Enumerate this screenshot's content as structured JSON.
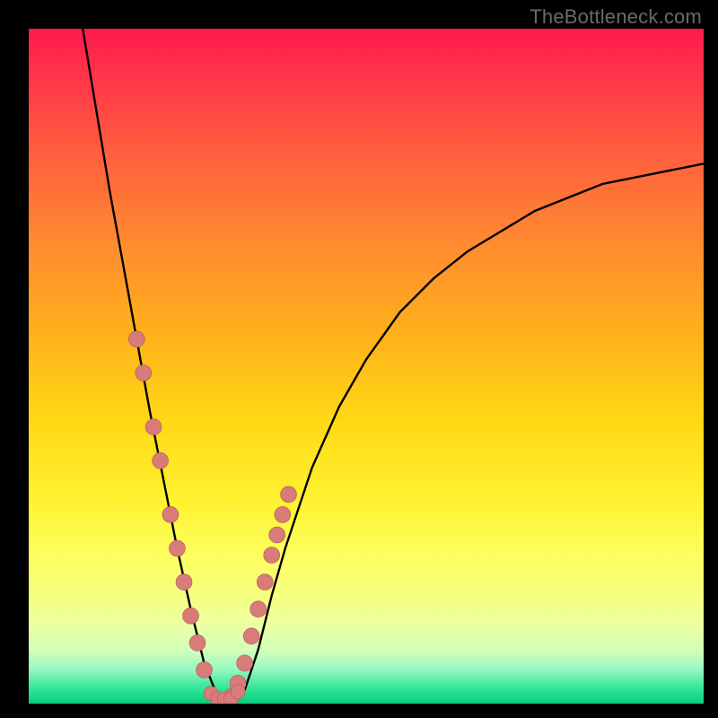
{
  "watermark": {
    "text": "TheBottleneck.com"
  },
  "colors": {
    "frame": "#000000",
    "curve": "#000000",
    "dot_fill": "#d87b79",
    "dot_stroke": "#b05a58",
    "gradient_stops": [
      "#ff1a4c",
      "#ff3149",
      "#ff5d3f",
      "#ff8b2f",
      "#ffb31a",
      "#ffd815",
      "#fff230",
      "#fdff60",
      "#f6ff80",
      "#edffa0",
      "#d4ffb8",
      "#96f7c2",
      "#4be9a2",
      "#1fe08e",
      "#10c97e"
    ]
  },
  "chart_data": {
    "type": "line",
    "title": "",
    "xlabel": "",
    "ylabel": "",
    "xlim": [
      0,
      100
    ],
    "ylim": [
      0,
      100
    ],
    "grid": false,
    "legend": false,
    "note": "V-shaped bottleneck curve; y≈0 at trough near x≈26–30; left branch steep, right branch asymptotes toward y≈80 at x=100. Values estimated from pixels.",
    "series": [
      {
        "name": "curve",
        "x": [
          8,
          10,
          12,
          14,
          16,
          18,
          20,
          22,
          24,
          26,
          28,
          30,
          32,
          34,
          36,
          38,
          42,
          46,
          50,
          55,
          60,
          65,
          70,
          75,
          80,
          85,
          90,
          95,
          100
        ],
        "y": [
          100,
          88,
          76,
          65,
          54,
          43,
          33,
          23,
          14,
          6,
          1,
          0,
          2,
          8,
          16,
          23,
          35,
          44,
          51,
          58,
          63,
          67,
          70,
          73,
          75,
          77,
          78,
          79,
          80
        ]
      }
    ],
    "dots_left_branch": [
      {
        "x": 16.0,
        "y": 54
      },
      {
        "x": 17.0,
        "y": 49
      },
      {
        "x": 18.5,
        "y": 41
      },
      {
        "x": 19.5,
        "y": 36
      },
      {
        "x": 21.0,
        "y": 28
      },
      {
        "x": 22.0,
        "y": 23
      },
      {
        "x": 23.0,
        "y": 18
      },
      {
        "x": 24.0,
        "y": 13
      },
      {
        "x": 25.0,
        "y": 9
      },
      {
        "x": 26.0,
        "y": 5
      }
    ],
    "dots_right_branch": [
      {
        "x": 30.0,
        "y": 1
      },
      {
        "x": 31.0,
        "y": 3
      },
      {
        "x": 32.0,
        "y": 6
      },
      {
        "x": 33.0,
        "y": 10
      },
      {
        "x": 34.0,
        "y": 14
      },
      {
        "x": 35.0,
        "y": 18
      },
      {
        "x": 36.0,
        "y": 22
      },
      {
        "x": 36.8,
        "y": 25
      },
      {
        "x": 37.6,
        "y": 28
      },
      {
        "x": 38.5,
        "y": 31
      }
    ],
    "dots_trough": [
      {
        "x": 27.0,
        "y": 1.5
      },
      {
        "x": 28.0,
        "y": 0.8
      },
      {
        "x": 29.0,
        "y": 0.6
      },
      {
        "x": 30.0,
        "y": 0.8
      },
      {
        "x": 31.0,
        "y": 1.8
      }
    ]
  }
}
